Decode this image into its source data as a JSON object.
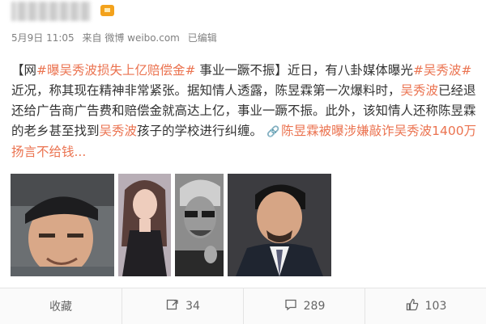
{
  "header": {
    "meta_date": "5月9日 11:05",
    "meta_source": "来自 微博 weibo.com",
    "meta_edited": "已编辑"
  },
  "post": {
    "segments": [
      {
        "text": "【网",
        "kind": "plain"
      },
      {
        "text": "#曝吴秀波损失上亿赔偿金#",
        "kind": "tag"
      },
      {
        "text": " 事业一蹶不振】近日，有八卦媒体曝光",
        "kind": "plain"
      },
      {
        "text": "#吴秀波#",
        "kind": "tag"
      },
      {
        "text": "近况，称其现在精神非常紧张。据知情人透露，陈昱霖第一次爆料时，",
        "kind": "plain"
      },
      {
        "text": "吴秀波",
        "kind": "mention"
      },
      {
        "text": "已经退还给广告商广告费和赔偿金就高达上亿，事业一蹶不振。此外，该知情人还称陈昱霖的老乡甚至找到",
        "kind": "plain"
      },
      {
        "text": "吴秀波",
        "kind": "mention"
      },
      {
        "text": "孩子的学校进行纠缠。 ",
        "kind": "plain"
      },
      {
        "text": "陈昱霖被曝涉嫌敲诈吴秀波1400万 扬言不给钱...",
        "kind": "link"
      }
    ]
  },
  "photos": [
    {
      "name": "photo-man-cap"
    },
    {
      "name": "photo-woman"
    },
    {
      "name": "photo-man-sunglasses"
    },
    {
      "name": "photo-man-suit"
    }
  ],
  "footer": {
    "favorite_label": "收藏",
    "repost_count": "34",
    "comment_count": "289",
    "like_count": "103"
  },
  "colors": {
    "accent": "#eb7350",
    "text": "#333333",
    "meta": "#808080",
    "vip_badge": "#f3a21c"
  },
  "icons": [
    "vip-badge-icon",
    "link-icon",
    "repost-icon",
    "comment-icon",
    "like-icon"
  ]
}
